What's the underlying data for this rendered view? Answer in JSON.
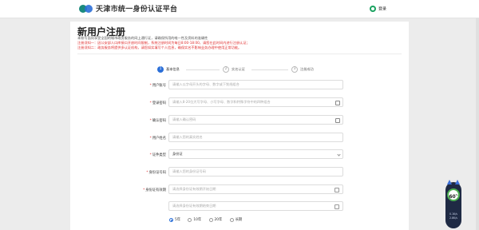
{
  "header": {
    "site_title": "天津市统一身份认证平台",
    "login_label": "登录"
  },
  "page": {
    "title": "新用户注册",
    "notices": [
      "本账号面向享受全国的城市政务服务的网上通行证，请确保所用的唯一性及资料的准确性",
      "注册须知一：因公安部人口库接口开放时间限制，系统注册时间为每日8:00-18:00，请您在此时间内进行注册认证；",
      "注册须知二：政务服务将提供多认证机构，请您如实填写个人信息，确保实名不影响业务办理中使用正常功能。"
    ]
  },
  "steps": [
    {
      "num": "1",
      "label": "基本信息",
      "active": true
    },
    {
      "num": "2",
      "label": "实名认证",
      "active": false
    },
    {
      "num": "3",
      "label": "注册成功",
      "active": false
    }
  ],
  "form": {
    "username": {
      "label": "用户账号",
      "placeholder": "请输入以字母开头的字母、数字或下划线组合"
    },
    "password": {
      "label": "登录密码",
      "placeholder": "请输入8-20位大写字母、小写字母、数字和特殊字符中的四种组合"
    },
    "confirm": {
      "label": "确认密码",
      "placeholder": "请输入确认密码"
    },
    "name": {
      "label": "用户姓名",
      "placeholder": "请输入您的真实姓名"
    },
    "id_type": {
      "label": "证件类型",
      "value": "身份证"
    },
    "id_number": {
      "label": "身份证号码",
      "placeholder": "请输入您的身份证号码"
    },
    "validity": {
      "label": "身份证有效期",
      "start_placeholder": "请选择身份证有效期开始日期",
      "end_placeholder": "请选择身份证有效期结束日期"
    },
    "validity_options": [
      "5年",
      "10年",
      "20年",
      "长期"
    ],
    "validity_selected": "5年"
  },
  "widget": {
    "percent": "60",
    "unit": "%",
    "up": "0.1K/s",
    "down": "2.8K/s"
  },
  "colors": {
    "accent": "#2b6fd8",
    "required": "#e03030",
    "brand_green": "#1a8a7d"
  }
}
